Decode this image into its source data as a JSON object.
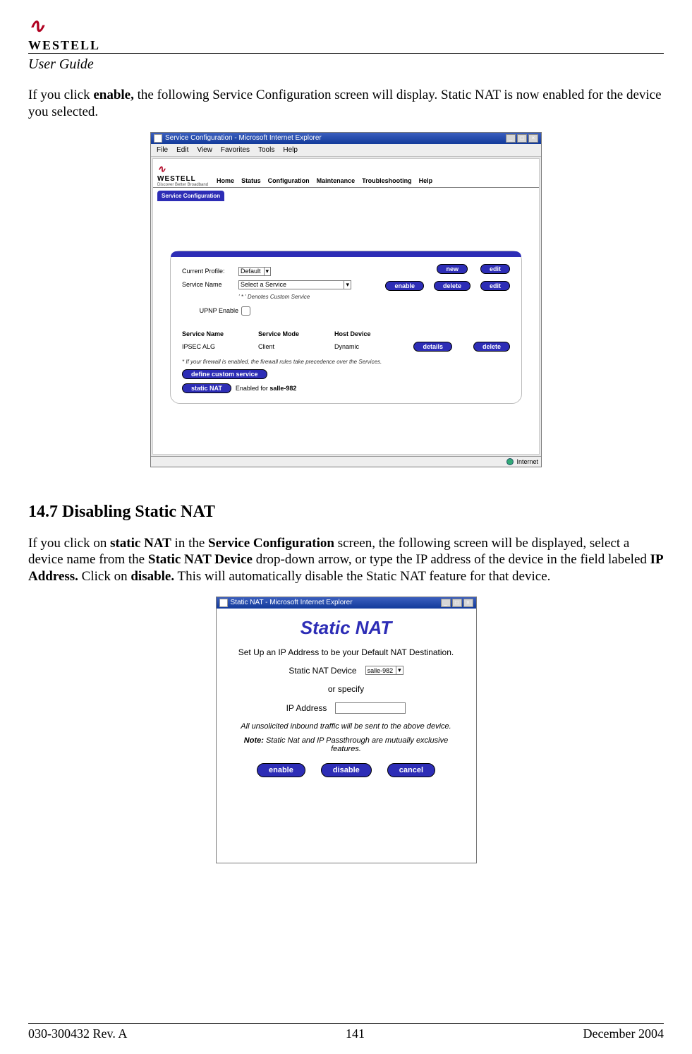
{
  "header": {
    "brand": "WESTELL",
    "subhead": "User Guide"
  },
  "para1_prefix": "If you click ",
  "para1_bold": "enable,",
  "para1_rest": " the following Service Configuration screen will display. Static NAT is now enabled for the device you selected.",
  "shot1": {
    "title": "Service Configuration - Microsoft Internet Explorer",
    "menus": [
      "File",
      "Edit",
      "View",
      "Favorites",
      "Tools",
      "Help"
    ],
    "brand": "WESTELL",
    "tagline": "Discover Better Broadband",
    "nav": [
      "Home",
      "Status",
      "Configuration",
      "Maintenance",
      "Troubleshooting",
      "Help"
    ],
    "tab": "Service Configuration",
    "current_profile_label": "Current Profile:",
    "current_profile_value": "Default",
    "service_name_label": "Service Name",
    "service_name_value": "Select a Service",
    "service_name_note": "' * ' Denotes Custom Service",
    "upnp_label": "UPNP Enable",
    "btns_top": {
      "new": "new",
      "edit": "edit"
    },
    "btns_mid": {
      "enable": "enable",
      "delete": "delete",
      "edit": "edit"
    },
    "table": {
      "headers": [
        "Service Name",
        "Service Mode",
        "Host Device"
      ],
      "row": {
        "name": "IPSEC ALG",
        "mode": "Client",
        "host": "Dynamic"
      },
      "row_btns": {
        "details": "details",
        "delete": "delete"
      }
    },
    "firewall_note": "* If your firewall is enabled, the firewall rules take precedence over the Services.",
    "define_custom": "define custom service",
    "static_nat": "static NAT",
    "static_nat_status_prefix": "Enabled for ",
    "static_nat_status_device": "salle-982",
    "status_internet": "Internet"
  },
  "section_heading": "14.7  Disabling Static NAT",
  "para2_segments": {
    "s0": "If you click on ",
    "b0": "static NAT",
    "s1": " in the ",
    "b1": "Service Configuration",
    "s2": " screen, the following screen will be displayed, select a device name from the ",
    "b2": "Static NAT Device",
    "s3": " drop-down arrow, or type the IP address of the device in the field labeled ",
    "b3": "IP Address.",
    "s4": " Click on ",
    "b4": "disable.",
    "s5": " This will automatically disable the Static NAT feature for that device."
  },
  "shot2": {
    "title": "Static NAT - Microsoft Internet Explorer",
    "heading": "Static NAT",
    "instr": "Set Up an IP Address to be your Default NAT Destination.",
    "device_label": "Static NAT Device",
    "device_value": "salle-982",
    "or_specify": "or specify",
    "ip_label": "IP Address",
    "note1": "All unsolicited inbound traffic will be sent to the above device.",
    "note2_label": "Note:",
    "note2": " Static Nat and IP Passthrough are mutually exclusive features.",
    "btns": {
      "enable": "enable",
      "disable": "disable",
      "cancel": "cancel"
    }
  },
  "footer": {
    "left": "030-300432 Rev. A",
    "center": "141",
    "right": "December 2004"
  }
}
